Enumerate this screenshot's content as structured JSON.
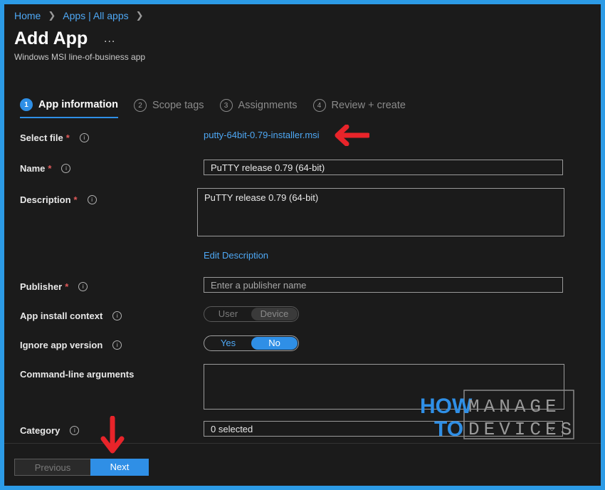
{
  "breadcrumb": {
    "home": "Home",
    "apps": "Apps | All apps"
  },
  "header": {
    "title": "Add App",
    "more": "...",
    "subtitle": "Windows MSI line-of-business app"
  },
  "tabs": [
    {
      "num": "1",
      "label": "App information"
    },
    {
      "num": "2",
      "label": "Scope tags"
    },
    {
      "num": "3",
      "label": "Assignments"
    },
    {
      "num": "4",
      "label": "Review + create"
    }
  ],
  "form": {
    "select_file": {
      "label": "Select file",
      "value": "putty-64bit-0.79-installer.msi"
    },
    "name": {
      "label": "Name",
      "value": "PuTTY release 0.79 (64-bit)"
    },
    "description": {
      "label": "Description",
      "value": "PuTTY release 0.79 (64-bit)",
      "edit_link": "Edit Description"
    },
    "publisher": {
      "label": "Publisher",
      "placeholder": "Enter a publisher name"
    },
    "install_context": {
      "label": "App install context",
      "option_user": "User",
      "option_device": "Device",
      "selected": "Device"
    },
    "ignore_version": {
      "label": "Ignore app version",
      "option_yes": "Yes",
      "option_no": "No",
      "selected": "No"
    },
    "cmd_args": {
      "label": "Command-line arguments",
      "value": ""
    },
    "category": {
      "label": "Category",
      "value": "0 selected"
    }
  },
  "footer": {
    "previous": "Previous",
    "next": "Next"
  },
  "watermark": {
    "line1a": "HOW",
    "line1b": "MANAGE",
    "line2a": "TO",
    "line2b": "DEVICES"
  },
  "colors": {
    "accent": "#2f8fe6",
    "link": "#4ea8f5",
    "annotation_arrow": "#e8242a",
    "frame": "#2c9be6"
  }
}
